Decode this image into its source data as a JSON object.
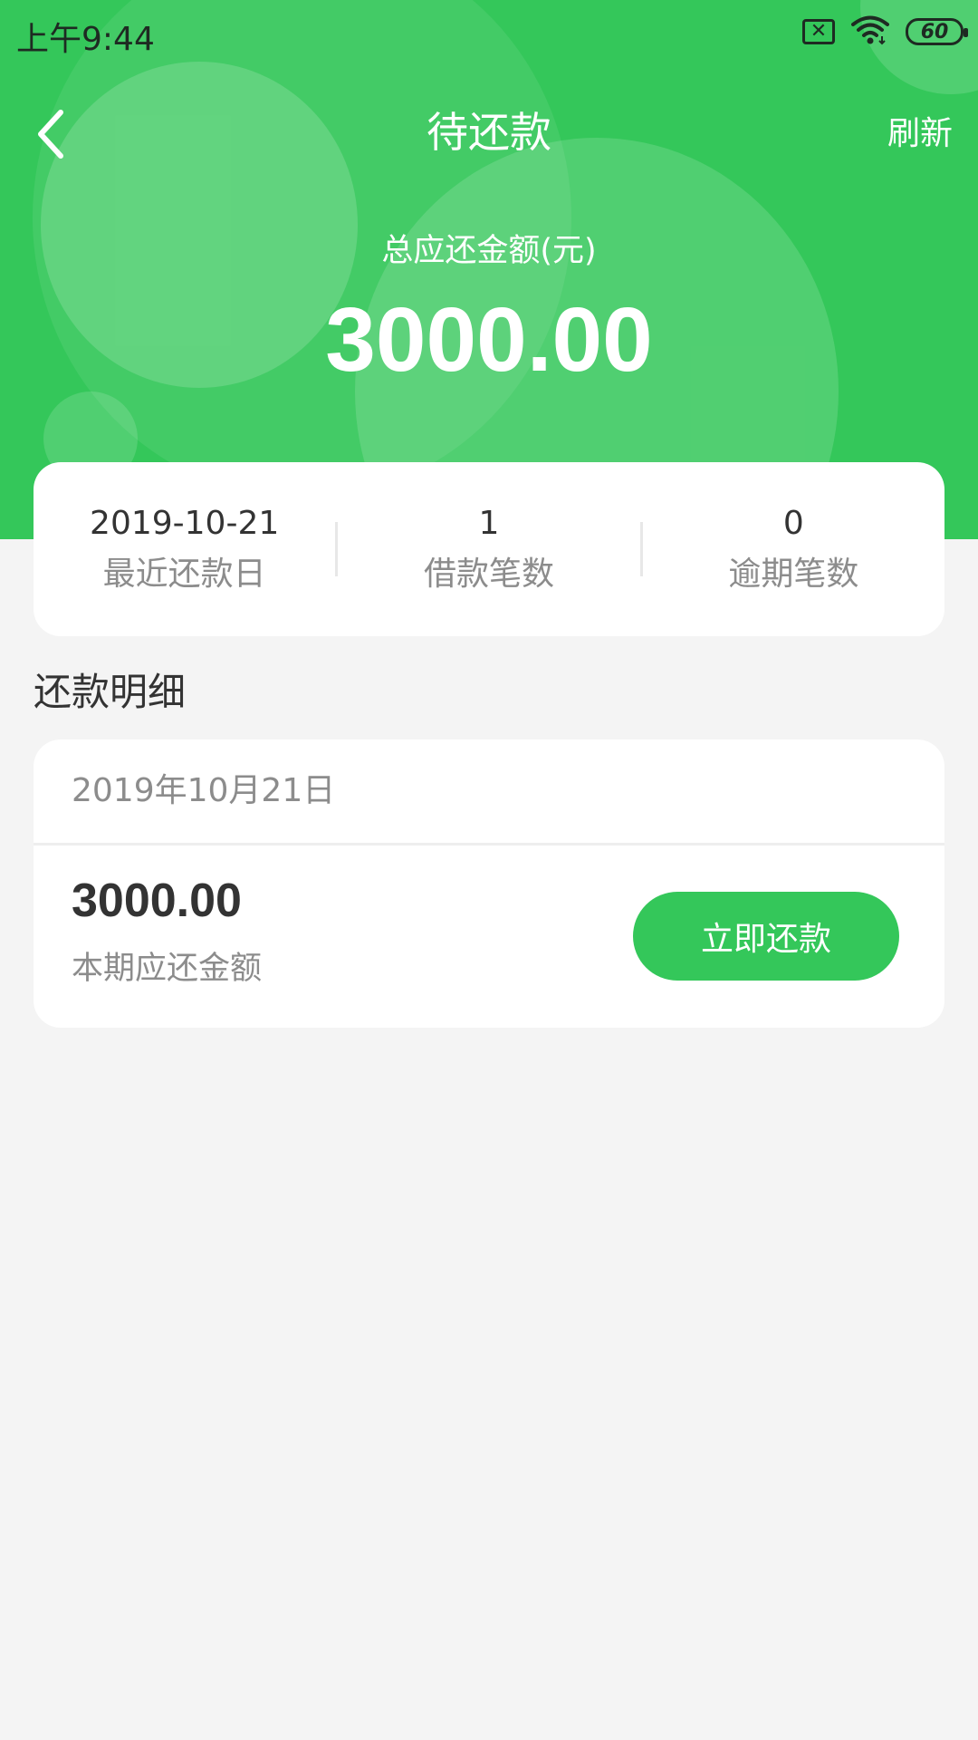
{
  "status_bar": {
    "time": "上午9:44",
    "battery_level": "60",
    "icons": [
      "no-sim-icon",
      "wifi-icon",
      "battery-icon"
    ]
  },
  "nav": {
    "back_icon": "chevron-left-icon",
    "title": "待还款",
    "refresh_label": "刷新"
  },
  "total": {
    "label": "总应还金额(元)",
    "amount": "3000.00"
  },
  "summary": {
    "items": [
      {
        "value": "2019-10-21",
        "label": "最近还款日"
      },
      {
        "value": "1",
        "label": "借款笔数"
      },
      {
        "value": "0",
        "label": "逾期笔数"
      }
    ]
  },
  "details": {
    "section_title": "还款明细",
    "entries": [
      {
        "date": "2019年10月21日",
        "amount": "3000.00",
        "amount_label": "本期应还金额",
        "action_label": "立即还款"
      }
    ]
  },
  "colors": {
    "brand_green": "#34c75a",
    "background": "#f4f4f4",
    "card": "#ffffff",
    "text_primary": "#333333",
    "text_secondary": "#8c8c8c"
  }
}
